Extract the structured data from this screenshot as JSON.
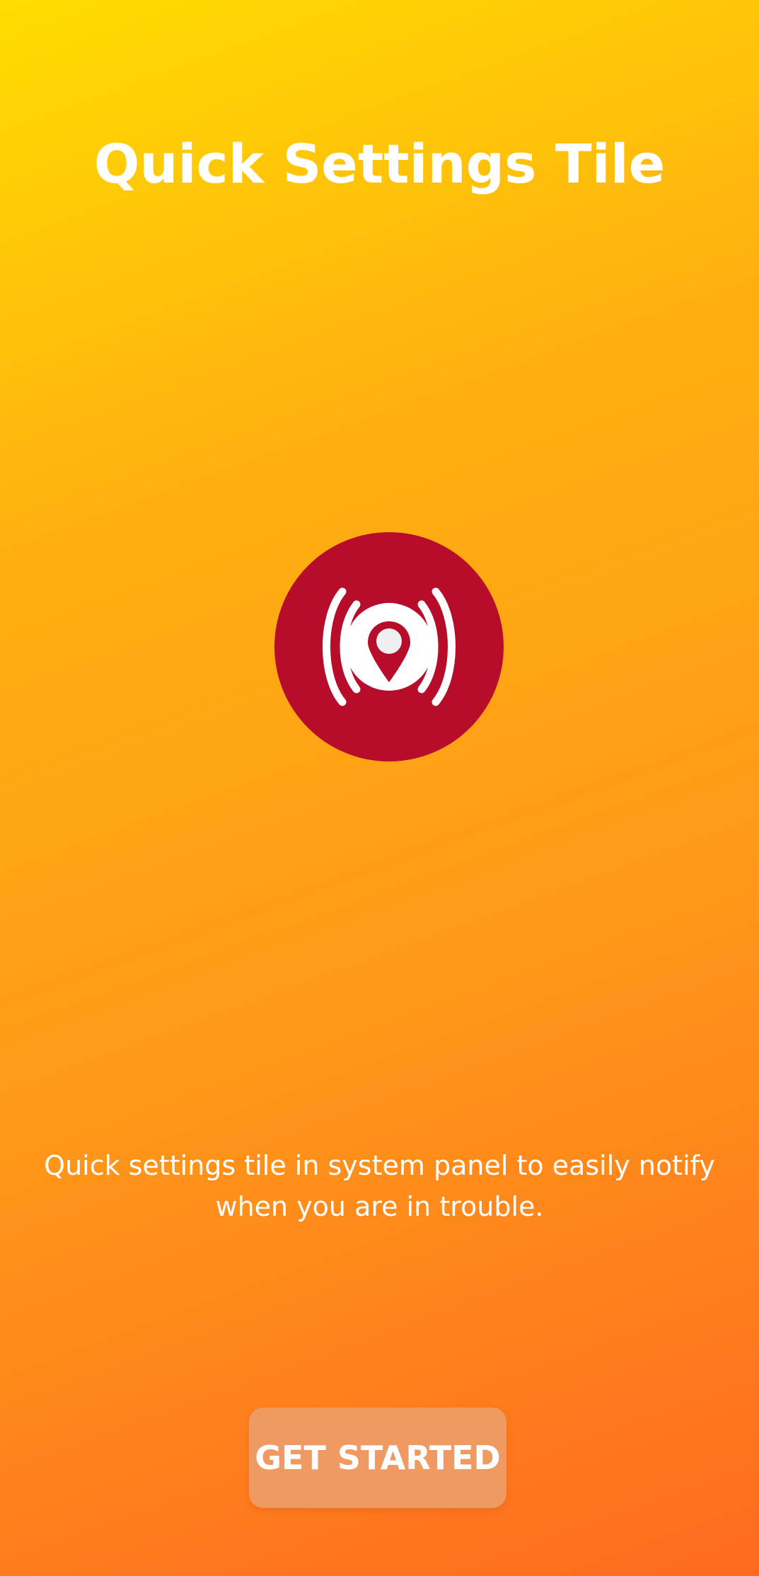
{
  "screen": {
    "title": "Quick Settings Tile",
    "description": "Quick settings tile in system panel to easily notify when you are in trouble.",
    "button_label": "GET STARTED"
  },
  "icons": {
    "logo": "location-broadcast-icon"
  },
  "colors": {
    "gradient_start": "#FFDC00",
    "gradient_end": "#FF6A20",
    "logo_background": "#B80D2A",
    "button_background": "#EE9A62",
    "text": "#FFFFFF"
  }
}
